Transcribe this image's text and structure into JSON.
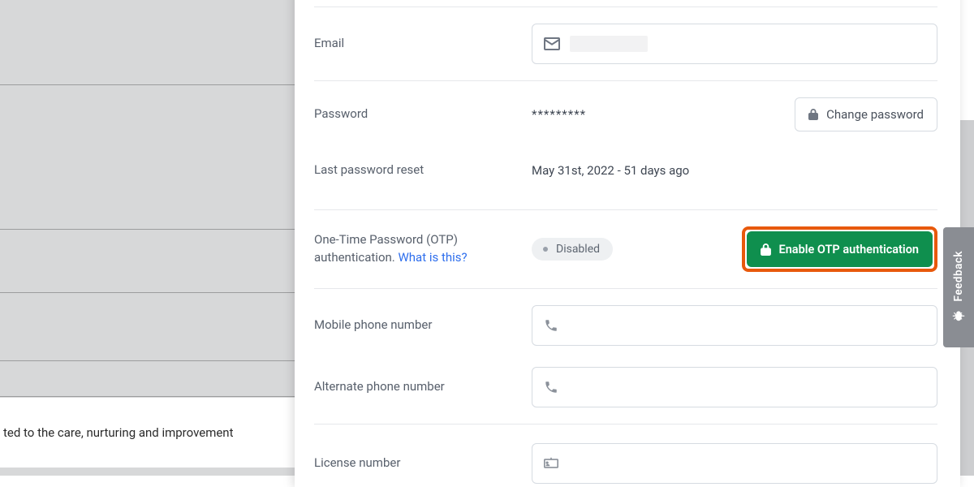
{
  "background": {
    "visible_text": "ted to the care, nurturing and improvement"
  },
  "fields": {
    "email": {
      "label": "Email",
      "value": ""
    },
    "password": {
      "label": "Password",
      "masked": "*********",
      "change_button": "Change password"
    },
    "last_reset": {
      "label": "Last password reset",
      "value": "May 31st, 2022 - 51 days ago"
    },
    "otp": {
      "label_line1": "One-Time Password (OTP)",
      "label_line2_prefix": "authentication. ",
      "help_link": "What is this?",
      "status": "Disabled",
      "enable_button": "Enable OTP authentication"
    },
    "mobile": {
      "label": "Mobile phone number",
      "value": ""
    },
    "alternate": {
      "label": "Alternate phone number",
      "value": ""
    },
    "license": {
      "label": "License number",
      "value": ""
    }
  },
  "feedback": {
    "label": "Feedback"
  }
}
